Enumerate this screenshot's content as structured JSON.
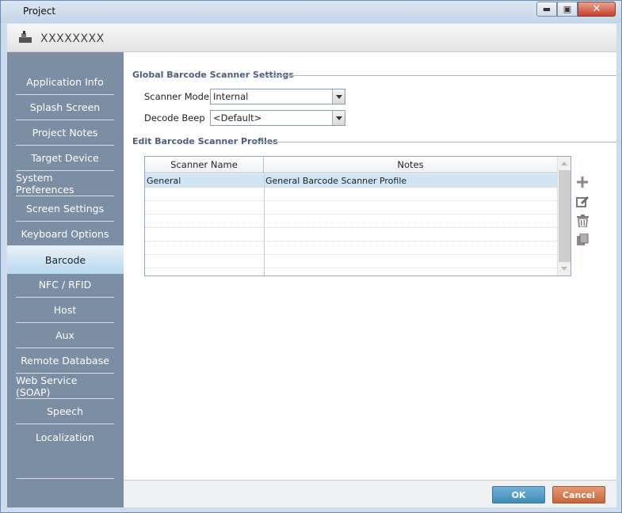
{
  "window": {
    "title": "Project"
  },
  "project": {
    "name": "XXXXXXXX"
  },
  "sidebar": {
    "items": [
      {
        "label": "Application Info"
      },
      {
        "label": "Splash Screen"
      },
      {
        "label": "Project Notes"
      },
      {
        "label": "Target Device"
      },
      {
        "label": "System Preferences"
      },
      {
        "label": "Screen Settings"
      },
      {
        "label": "Keyboard Options"
      },
      {
        "label": "Barcode",
        "active": true
      },
      {
        "label": "NFC / RFID"
      },
      {
        "label": "Host"
      },
      {
        "label": "Aux"
      },
      {
        "label": "Remote Database"
      },
      {
        "label": "Web Service (SOAP)"
      },
      {
        "label": "Speech"
      },
      {
        "label": "Localization"
      }
    ]
  },
  "global_settings": {
    "title": "Global Barcode Scanner Settings",
    "scanner_mode": {
      "label": "Scanner Mode",
      "value": "Internal"
    },
    "decode_beep": {
      "label": "Decode Beep",
      "value": "<Default>"
    }
  },
  "profiles": {
    "title": "Edit Barcode Scanner Profiles",
    "columns": [
      "Scanner Name",
      "Notes"
    ],
    "rows": [
      {
        "name": "General",
        "notes": "General Barcode Scanner Profile",
        "selected": true
      }
    ],
    "toolbar_icons": [
      "add-icon",
      "edit-icon",
      "delete-icon",
      "copy-icon"
    ]
  },
  "footer": {
    "ok_label": "OK",
    "cancel_label": "Cancel"
  },
  "colors": {
    "sidebar": "#7b8ea3",
    "active_item": "#c9e2f3",
    "ok": "#4d9cc7",
    "cancel": "#d87449"
  }
}
